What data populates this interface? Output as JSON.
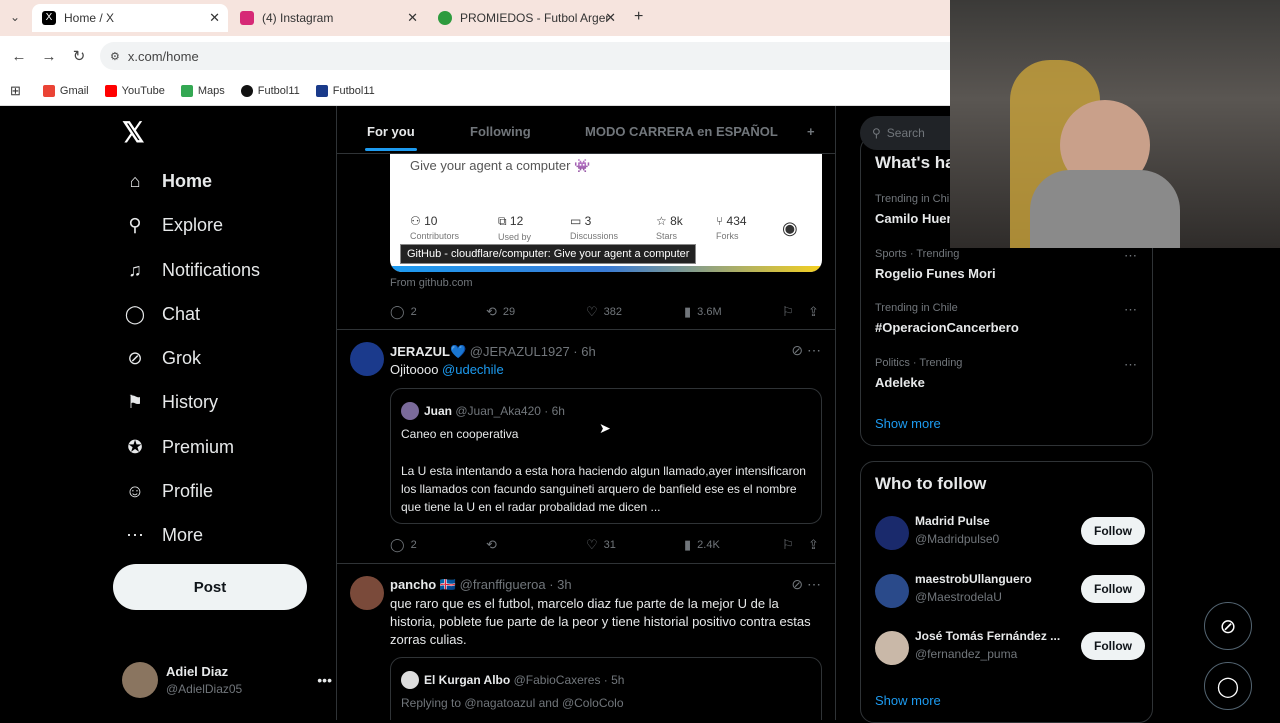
{
  "browser": {
    "tabs": [
      {
        "title": "Home / X",
        "color": "#000000"
      },
      {
        "title": "(4) Instagram",
        "color": "#d62976"
      },
      {
        "title": "PROMIEDOS - Futbol Argentino",
        "color": "#2e9b3e"
      }
    ],
    "url": "x.com/home",
    "bookmarks": [
      {
        "label": "Gmail",
        "color": "#ea4335"
      },
      {
        "label": "YouTube",
        "color": "#ff0000"
      },
      {
        "label": "Maps",
        "color": "#34a853"
      },
      {
        "label": "Futbol11",
        "color": "#111111"
      },
      {
        "label": "Futbol11",
        "color": "#1a3a8a"
      }
    ]
  },
  "nav": {
    "items": [
      {
        "label": "Home",
        "icon": "home-icon",
        "glyph": "⌂"
      },
      {
        "label": "Explore",
        "icon": "search-icon",
        "glyph": "⚲"
      },
      {
        "label": "Notifications",
        "icon": "bell-icon",
        "glyph": "🔔"
      },
      {
        "label": "Chat",
        "icon": "chat-icon",
        "glyph": "◯"
      },
      {
        "label": "Grok",
        "icon": "grok-icon",
        "glyph": "⊘"
      },
      {
        "label": "History",
        "icon": "bookmark-icon",
        "glyph": "⚑"
      },
      {
        "label": "Premium",
        "icon": "verified-icon",
        "glyph": "✪"
      },
      {
        "label": "Profile",
        "icon": "person-icon",
        "glyph": "☺"
      },
      {
        "label": "More",
        "icon": "more-icon",
        "glyph": "⋯"
      }
    ],
    "post_label": "Post",
    "user_name": "Adiel Diaz",
    "user_handle": "@AdielDiaz05"
  },
  "feed": {
    "tabs": [
      "For you",
      "Following",
      "MODO CARRERA en ESPAÑOL",
      "+"
    ],
    "card": {
      "description": "Give your agent a computer 👾",
      "stats": [
        {
          "value": "10",
          "label": "Contributors"
        },
        {
          "value": "12",
          "label": "Used by"
        },
        {
          "value": "3",
          "label": "Discussions"
        },
        {
          "value": "8k",
          "label": "Stars"
        },
        {
          "value": "434",
          "label": "Forks"
        }
      ],
      "tooltip": "GitHub - cloudflare/computer: Give your agent a computer",
      "from": "From github.com"
    },
    "post0_actions": {
      "replies": "2",
      "reposts": "29",
      "likes": "382",
      "views": "3.6M"
    },
    "post1": {
      "name": "JERAZUL💙",
      "handle": "@JERAZUL1927 · 6h",
      "text": "Ojitoooo",
      "mention": "@udechile",
      "quote": {
        "name": "Juan",
        "handle": "@Juan_Aka420 · 6h",
        "line1": "Caneo en cooperativa",
        "line2": "La U esta intentando a esta hora haciendo algun llamado,ayer intensificaron los llamados con facundo sanguineti arquero de banfield ese es el nombre que tiene la U en el radar probalidad me dicen ..."
      },
      "actions": {
        "replies": "2",
        "reposts": "",
        "likes": "31",
        "views": "2.4K"
      }
    },
    "post2": {
      "name": "pancho 🇮🇸",
      "handle": "@franffigueroa · 3h",
      "text": "que raro que es el futbol, marcelo diaz fue parte de la mejor U de la historia, poblete fue parte de la peor y tiene historial positivo contra estas zorras culias.",
      "quote": {
        "name": "El Kurgan Albo",
        "handle": "@FabioCaxeres · 5h",
        "reply": "Replying to @nagatoazul and @ColoColo"
      }
    }
  },
  "sidebar": {
    "search_placeholder": "Search",
    "whats_happening": "What's ha",
    "trends": [
      {
        "meta": "Trending in Chi",
        "name": "Camilo Huer"
      },
      {
        "meta": "Sports · Trending",
        "name": "Rogelio Funes Mori"
      },
      {
        "meta": "Trending in Chile",
        "name": "#OperacionCancerbero"
      },
      {
        "meta": "Politics · Trending",
        "name": "Adeleke"
      }
    ],
    "show_more": "Show more",
    "who_to_follow": "Who to follow",
    "suggestions": [
      {
        "name": "Madrid Pulse",
        "handle": "@Madridpulse0",
        "color": "#1a2a6c"
      },
      {
        "name": "maestrobUllanguero",
        "handle": "@MaestrodelaU",
        "color": "#2a4a8a"
      },
      {
        "name": "José Tomás Fernández ...",
        "handle": "@fernandez_puma",
        "color": "#c9b8a8"
      }
    ],
    "follow_label": "Follow"
  }
}
